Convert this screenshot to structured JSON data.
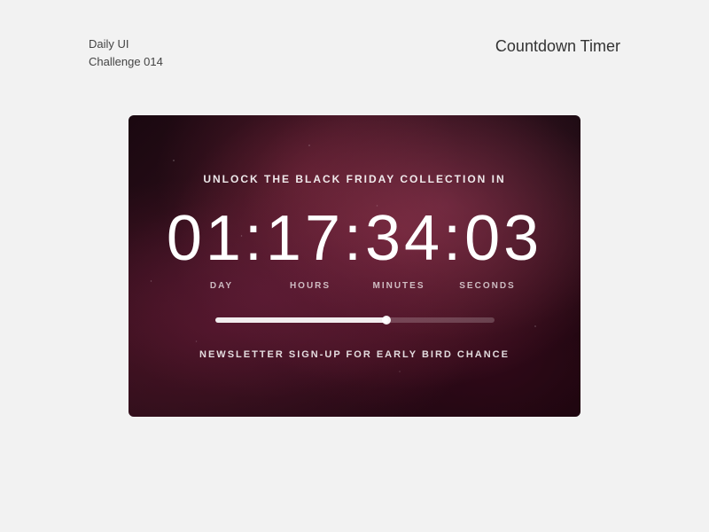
{
  "header": {
    "left_line1": "Daily UI",
    "left_line2": "Challenge 014",
    "right": "Countdown Timer"
  },
  "card": {
    "unlock_text": "UNLOCK THE BLACK FRIDAY COLLECTION IN",
    "countdown": {
      "display": "01:17:34:03",
      "days": "01",
      "hours": "17",
      "minutes": "34",
      "seconds": "03"
    },
    "labels": [
      "DAY",
      "HOURS",
      "MINUTES",
      "SECONDS"
    ],
    "progress_percent": 62,
    "newsletter_text": "NEWSLETTER SIGN-UP FOR EARLY BIRD CHANCE"
  }
}
